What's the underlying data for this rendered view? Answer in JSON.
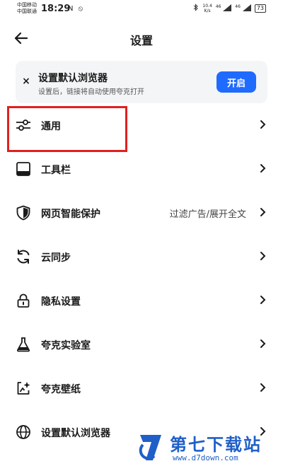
{
  "status_bar": {
    "carrier1": "中国移动",
    "carrier2": "中国联通",
    "time": "18:29",
    "left_icons": "N ⦸",
    "speed": "10.4",
    "speed_unit": "K/s",
    "signal_4g_a": "46",
    "signal_4g_b": "46",
    "battery": "73"
  },
  "header": {
    "title": "设置"
  },
  "banner": {
    "close_glyph": "×",
    "title": "设置默认浏览器",
    "desc": "设置后，链接将自动使用夸克打开",
    "button": "开启",
    "accent": "#1f6bff"
  },
  "menu": {
    "items": [
      {
        "label": "通用",
        "icon": "sliders-icon"
      },
      {
        "label": "工具栏",
        "icon": "toolbar-icon"
      },
      {
        "label": "网页智能保护",
        "value": "过滤广告/展开全文",
        "icon": "shield-icon"
      },
      {
        "label": "云同步",
        "icon": "sync-icon"
      },
      {
        "label": "隐私设置",
        "icon": "lock-icon"
      },
      {
        "label": "夸克实验室",
        "icon": "flask-icon"
      },
      {
        "label": "夸克壁纸",
        "icon": "wallpaper-icon"
      },
      {
        "label": "设置默认浏览器",
        "icon": "globe-icon"
      }
    ]
  },
  "watermark": {
    "name": "第七下载站",
    "url": "www.d7down.com",
    "color": "#1f5fc8"
  },
  "highlight_color": "#e02020"
}
